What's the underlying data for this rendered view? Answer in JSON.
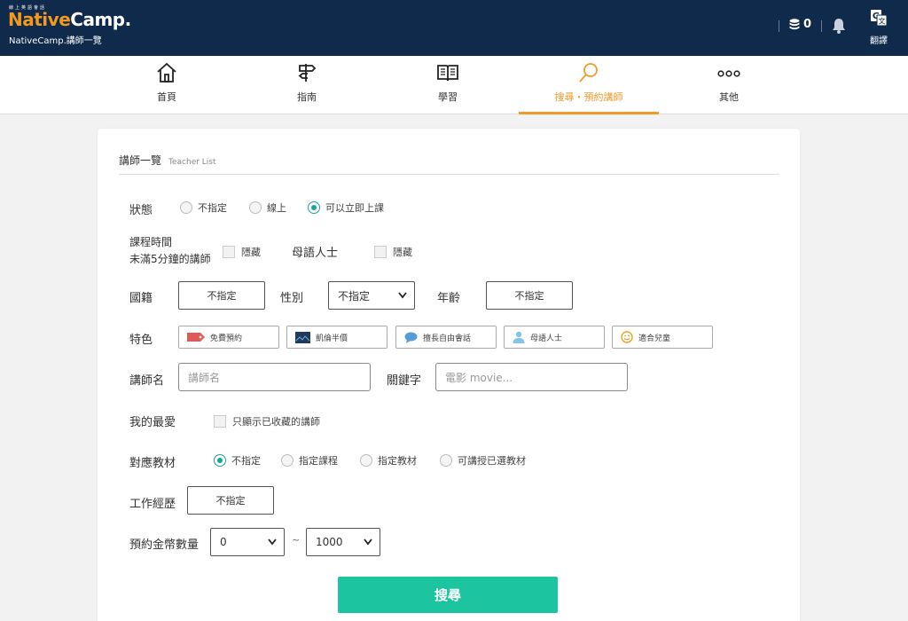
{
  "header": {
    "logo_tag": "線上英語會話",
    "logo_part1": "Native",
    "logo_part2": "Camp.",
    "subtitle": "NativeCamp.講師一覽",
    "coins": "0",
    "translate_label": "翻譯"
  },
  "nav": {
    "items": [
      {
        "label": "首頁",
        "icon": "home-icon"
      },
      {
        "label": "指南",
        "icon": "signpost-icon"
      },
      {
        "label": "學習",
        "icon": "book-icon"
      },
      {
        "label": "搜尋・預約講師",
        "icon": "magnifier-icon"
      },
      {
        "label": "其他",
        "icon": "more-icon"
      }
    ],
    "active_index": 3
  },
  "card": {
    "title": "講師一覽",
    "title_en": "Teacher List"
  },
  "form": {
    "status": {
      "label": "狀態",
      "options": [
        "不指定",
        "線上",
        "可以立即上課"
      ],
      "selected": 2
    },
    "lesson_time": {
      "label_line1": "課程時間",
      "label_line2": "未滿5分鐘的講師",
      "checkbox": "隱藏"
    },
    "native": {
      "label": "母語人士",
      "checkbox": "隱藏"
    },
    "nationality": {
      "label": "國籍",
      "value": "不指定"
    },
    "gender": {
      "label": "性別",
      "value": "不指定"
    },
    "age": {
      "label": "年齡",
      "value": "不指定"
    },
    "features": {
      "label": "特色",
      "items": [
        {
          "label": "免費預約",
          "icon": "tag-icon"
        },
        {
          "label": "凱倫半價",
          "icon": "photo-icon"
        },
        {
          "label": "擅長自由會話",
          "icon": "chat-icon"
        },
        {
          "label": "母語人士",
          "icon": "person-icon"
        },
        {
          "label": "適合兒童",
          "icon": "smile-icon"
        }
      ]
    },
    "teacher_name": {
      "label": "講師名",
      "placeholder": "講師名"
    },
    "keyword": {
      "label": "關鍵字",
      "placeholder": "電影 movie..."
    },
    "favorites": {
      "label": "我的最愛",
      "checkbox": "只顯示已收藏的講師"
    },
    "materials": {
      "label": "對應教材",
      "options": [
        "不指定",
        "指定課程",
        "指定教材",
        "可講授已選教材"
      ],
      "selected": 0
    },
    "experience": {
      "label": "工作經歷",
      "value": "不指定"
    },
    "coins_range": {
      "label": "預約金幣數量",
      "min": "0",
      "separator": "~",
      "max": "1000"
    },
    "search_button": "搜尋"
  },
  "colors": {
    "header_bg": "#0f2a4a",
    "accent_orange": "#f29a2e",
    "teal": "#1aa39a",
    "search_green": "#1dc4a0"
  }
}
